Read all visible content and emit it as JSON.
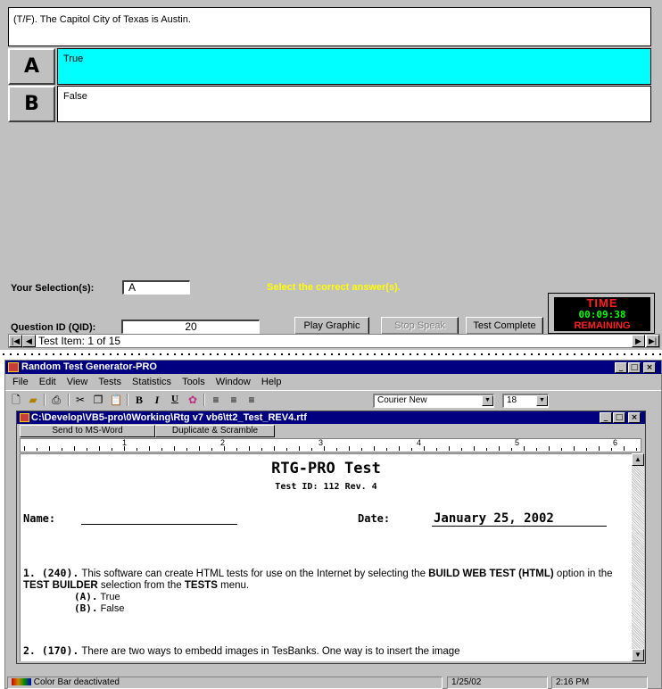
{
  "quiz": {
    "question": "(T/F). The Capitol City of Texas is Austin.",
    "answers": [
      {
        "letter": "A",
        "text": "True"
      },
      {
        "letter": "B",
        "text": "False"
      }
    ],
    "selection_label": "Your Selection(s):",
    "selection_value": "A",
    "instruction": "Select the correct answer(s).",
    "qid_label": "Question ID (QID):",
    "qid_value": "20",
    "buttons": {
      "play_graphic": "Play Graphic",
      "stop_speak": "Stop Speak",
      "test_complete": "Test Complete"
    },
    "timer": {
      "label": "TIME",
      "value": "00:09:38",
      "status": "REMAINING"
    },
    "nav": {
      "item_text": "Test Item: 1 of 15"
    }
  },
  "app": {
    "title": "Random Test Generator-PRO",
    "menu": [
      "File",
      "Edit",
      "View",
      "Tests",
      "Statistics",
      "Tools",
      "Window",
      "Help"
    ],
    "font_name": "Courier New",
    "font_size": "18",
    "doc": {
      "title": "C:\\Develop\\VB5-pro\\0Working\\Rtg v7 vb6\\tt2_Test_REV4.rtf",
      "send_button": "Send to MS-Word",
      "dup_button": "Duplicate & Scramble",
      "ruler_numbers": [
        "1",
        "2",
        "3",
        "4",
        "5",
        "6"
      ],
      "heading": "RTG-PRO Test",
      "subheading": "Test ID: 112  Rev. 4",
      "name_label": "Name:",
      "date_label": "Date:",
      "date_value": "January 25, 2002",
      "q1_num": "1. (240).",
      "q1_text_a": "This software can create HTML tests for use on the Internet by selecting the",
      "q1_bold_a": "BUILD WEB TEST (HTML)",
      "q1_text_b": "option in the",
      "q1_bold_b": "TEST BUILDER",
      "q1_text_c": "selection from the",
      "q1_bold_c": "TESTS",
      "q1_text_d": "menu.",
      "q1_opt_a_label": "(A).",
      "q1_opt_a": "True",
      "q1_opt_b_label": "(B).",
      "q1_opt_b": "False",
      "q2_num": "2. (170).",
      "q2_text": "There are two ways to embedd images in TesBanks. One way is to insert the image"
    },
    "status": {
      "message": "Color Bar deactivated",
      "date": "1/25/02",
      "time": "2:16 PM"
    }
  }
}
